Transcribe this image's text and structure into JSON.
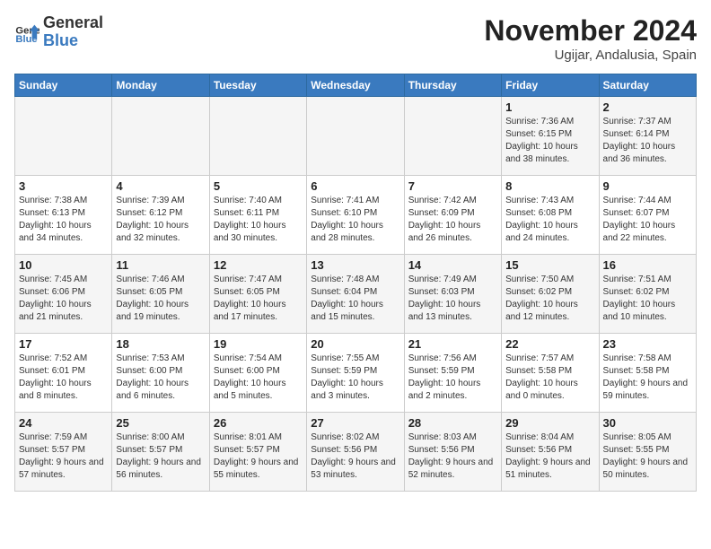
{
  "header": {
    "logo_general": "General",
    "logo_blue": "Blue",
    "month_title": "November 2024",
    "location": "Ugijar, Andalusia, Spain"
  },
  "days_of_week": [
    "Sunday",
    "Monday",
    "Tuesday",
    "Wednesday",
    "Thursday",
    "Friday",
    "Saturday"
  ],
  "weeks": [
    [
      {
        "day": "",
        "info": ""
      },
      {
        "day": "",
        "info": ""
      },
      {
        "day": "",
        "info": ""
      },
      {
        "day": "",
        "info": ""
      },
      {
        "day": "",
        "info": ""
      },
      {
        "day": "1",
        "info": "Sunrise: 7:36 AM\nSunset: 6:15 PM\nDaylight: 10 hours and 38 minutes."
      },
      {
        "day": "2",
        "info": "Sunrise: 7:37 AM\nSunset: 6:14 PM\nDaylight: 10 hours and 36 minutes."
      }
    ],
    [
      {
        "day": "3",
        "info": "Sunrise: 7:38 AM\nSunset: 6:13 PM\nDaylight: 10 hours and 34 minutes."
      },
      {
        "day": "4",
        "info": "Sunrise: 7:39 AM\nSunset: 6:12 PM\nDaylight: 10 hours and 32 minutes."
      },
      {
        "day": "5",
        "info": "Sunrise: 7:40 AM\nSunset: 6:11 PM\nDaylight: 10 hours and 30 minutes."
      },
      {
        "day": "6",
        "info": "Sunrise: 7:41 AM\nSunset: 6:10 PM\nDaylight: 10 hours and 28 minutes."
      },
      {
        "day": "7",
        "info": "Sunrise: 7:42 AM\nSunset: 6:09 PM\nDaylight: 10 hours and 26 minutes."
      },
      {
        "day": "8",
        "info": "Sunrise: 7:43 AM\nSunset: 6:08 PM\nDaylight: 10 hours and 24 minutes."
      },
      {
        "day": "9",
        "info": "Sunrise: 7:44 AM\nSunset: 6:07 PM\nDaylight: 10 hours and 22 minutes."
      }
    ],
    [
      {
        "day": "10",
        "info": "Sunrise: 7:45 AM\nSunset: 6:06 PM\nDaylight: 10 hours and 21 minutes."
      },
      {
        "day": "11",
        "info": "Sunrise: 7:46 AM\nSunset: 6:05 PM\nDaylight: 10 hours and 19 minutes."
      },
      {
        "day": "12",
        "info": "Sunrise: 7:47 AM\nSunset: 6:05 PM\nDaylight: 10 hours and 17 minutes."
      },
      {
        "day": "13",
        "info": "Sunrise: 7:48 AM\nSunset: 6:04 PM\nDaylight: 10 hours and 15 minutes."
      },
      {
        "day": "14",
        "info": "Sunrise: 7:49 AM\nSunset: 6:03 PM\nDaylight: 10 hours and 13 minutes."
      },
      {
        "day": "15",
        "info": "Sunrise: 7:50 AM\nSunset: 6:02 PM\nDaylight: 10 hours and 12 minutes."
      },
      {
        "day": "16",
        "info": "Sunrise: 7:51 AM\nSunset: 6:02 PM\nDaylight: 10 hours and 10 minutes."
      }
    ],
    [
      {
        "day": "17",
        "info": "Sunrise: 7:52 AM\nSunset: 6:01 PM\nDaylight: 10 hours and 8 minutes."
      },
      {
        "day": "18",
        "info": "Sunrise: 7:53 AM\nSunset: 6:00 PM\nDaylight: 10 hours and 6 minutes."
      },
      {
        "day": "19",
        "info": "Sunrise: 7:54 AM\nSunset: 6:00 PM\nDaylight: 10 hours and 5 minutes."
      },
      {
        "day": "20",
        "info": "Sunrise: 7:55 AM\nSunset: 5:59 PM\nDaylight: 10 hours and 3 minutes."
      },
      {
        "day": "21",
        "info": "Sunrise: 7:56 AM\nSunset: 5:59 PM\nDaylight: 10 hours and 2 minutes."
      },
      {
        "day": "22",
        "info": "Sunrise: 7:57 AM\nSunset: 5:58 PM\nDaylight: 10 hours and 0 minutes."
      },
      {
        "day": "23",
        "info": "Sunrise: 7:58 AM\nSunset: 5:58 PM\nDaylight: 9 hours and 59 minutes."
      }
    ],
    [
      {
        "day": "24",
        "info": "Sunrise: 7:59 AM\nSunset: 5:57 PM\nDaylight: 9 hours and 57 minutes."
      },
      {
        "day": "25",
        "info": "Sunrise: 8:00 AM\nSunset: 5:57 PM\nDaylight: 9 hours and 56 minutes."
      },
      {
        "day": "26",
        "info": "Sunrise: 8:01 AM\nSunset: 5:57 PM\nDaylight: 9 hours and 55 minutes."
      },
      {
        "day": "27",
        "info": "Sunrise: 8:02 AM\nSunset: 5:56 PM\nDaylight: 9 hours and 53 minutes."
      },
      {
        "day": "28",
        "info": "Sunrise: 8:03 AM\nSunset: 5:56 PM\nDaylight: 9 hours and 52 minutes."
      },
      {
        "day": "29",
        "info": "Sunrise: 8:04 AM\nSunset: 5:56 PM\nDaylight: 9 hours and 51 minutes."
      },
      {
        "day": "30",
        "info": "Sunrise: 8:05 AM\nSunset: 5:55 PM\nDaylight: 9 hours and 50 minutes."
      }
    ]
  ]
}
